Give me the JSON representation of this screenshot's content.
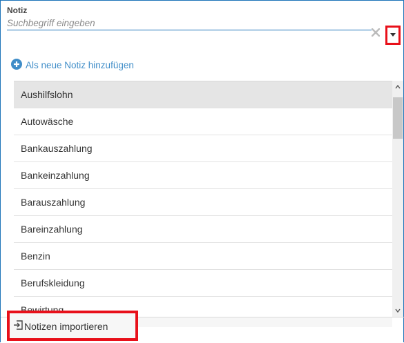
{
  "field": {
    "label": "Notiz",
    "placeholder": "Suchbegriff eingeben",
    "value": ""
  },
  "add_new": {
    "label": "Als neue Notiz hinzufügen"
  },
  "list": {
    "items": [
      "Aushilfslohn",
      "Autowäsche",
      "Bankauszahlung",
      "Bankeinzahlung",
      "Barauszahlung",
      "Bareinzahlung",
      "Benzin",
      "Berufskleidung",
      "Bewirtung"
    ],
    "selected_index": 0
  },
  "import": {
    "label": "Notizen importieren"
  },
  "colors": {
    "accent": "#1b72b8",
    "link": "#3f8dc8",
    "highlight": "#e8101a"
  },
  "icons": {
    "clear": "close-icon",
    "dropdown": "caret-down-icon",
    "add": "plus-circle-icon",
    "import": "import-icon",
    "scroll_up": "chevron-up-icon",
    "scroll_down": "chevron-down-icon"
  }
}
